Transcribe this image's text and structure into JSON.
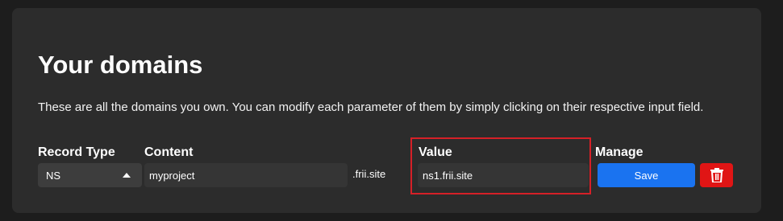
{
  "section": {
    "title": "Your domains",
    "description": "These are all the domains you own. You can modify each parameter of them by simply clicking on their respective input field."
  },
  "columns": {
    "record_type": "Record Type",
    "content": "Content",
    "value": "Value",
    "manage": "Manage"
  },
  "row": {
    "record_type": "NS",
    "content": "myproject",
    "suffix": ".frii.site",
    "value": "ns1.frii.site",
    "save_label": "Save"
  },
  "icons": {
    "record_type_caret": "caret-up-icon",
    "delete": "trash-icon"
  },
  "colors": {
    "save_button": "#1a73f0",
    "delete_button": "#e01515",
    "highlight": "#d62027"
  }
}
